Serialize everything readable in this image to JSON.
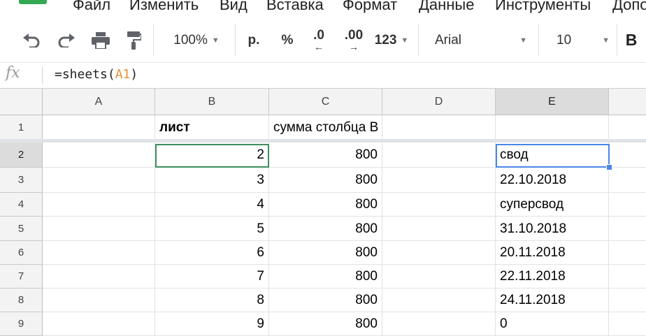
{
  "menu": [
    "Файл",
    "Изменить",
    "Вид",
    "Вставка",
    "Формат",
    "Данные",
    "Инструменты",
    "Допо"
  ],
  "toolbar": {
    "undo_icon": "undo-icon",
    "redo_icon": "redo-icon",
    "print_icon": "print-icon",
    "paint_format_icon": "paint-format-icon",
    "zoom": "100%",
    "currency": "р.",
    "percent": "%",
    "decrease_decimals": ".0",
    "increase_decimals": ".00",
    "more_formats": "123",
    "font": "Arial",
    "font_size": "10",
    "bold": "B"
  },
  "formula_bar": {
    "fx": "fx",
    "formula_prefix": "=sheets(",
    "formula_ref": "A1",
    "formula_suffix": ")"
  },
  "columns": [
    "A",
    "B",
    "C",
    "D",
    "E"
  ],
  "rows": [
    {
      "num": "1",
      "A": "",
      "B": "лист",
      "C": "сумма столбца B",
      "D": "",
      "E": ""
    },
    {
      "num": "2",
      "A": "",
      "B": "2",
      "C": "800",
      "D": "",
      "E": "свод"
    },
    {
      "num": "3",
      "A": "",
      "B": "3",
      "C": "800",
      "D": "",
      "E": "22.10.2018"
    },
    {
      "num": "4",
      "A": "",
      "B": "4",
      "C": "800",
      "D": "",
      "E": "суперсвод"
    },
    {
      "num": "5",
      "A": "",
      "B": "5",
      "C": "800",
      "D": "",
      "E": "31.10.2018"
    },
    {
      "num": "6",
      "A": "",
      "B": "6",
      "C": "800",
      "D": "",
      "E": "20.11.2018"
    },
    {
      "num": "7",
      "A": "",
      "B": "7",
      "C": "800",
      "D": "",
      "E": "22.11.2018"
    },
    {
      "num": "8",
      "A": "",
      "B": "8",
      "C": "800",
      "D": "",
      "E": "24.11.2018"
    },
    {
      "num": "9",
      "A": "",
      "B": "9",
      "C": "800",
      "D": "",
      "E": "0"
    }
  ],
  "selected_cell": "E2",
  "colors": {
    "accent_selection": "#4a86e8",
    "formula_reference": "#e69138",
    "brand": "#34a853"
  }
}
